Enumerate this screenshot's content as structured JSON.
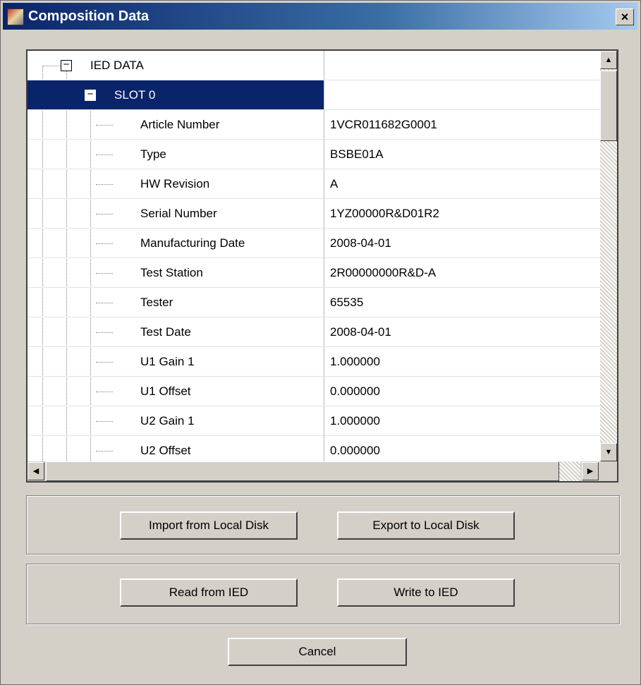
{
  "window": {
    "title": "Composition Data",
    "close_glyph": "×"
  },
  "tree": {
    "root": {
      "label": "IED DATA",
      "expander": "−"
    },
    "slot": {
      "label": "SLOT 0",
      "expander": "−"
    },
    "fields": [
      {
        "name": "Article Number",
        "value": "1VCR011682G0001"
      },
      {
        "name": "Type",
        "value": "BSBE01A"
      },
      {
        "name": "HW Revision",
        "value": "A"
      },
      {
        "name": "Serial Number",
        "value": "1YZ00000R&D01R2"
      },
      {
        "name": "Manufacturing Date",
        "value": "2008-04-01"
      },
      {
        "name": "Test Station",
        "value": "2R00000000R&D-A"
      },
      {
        "name": "Tester",
        "value": "65535"
      },
      {
        "name": "Test Date",
        "value": "2008-04-01"
      },
      {
        "name": "U1 Gain 1",
        "value": "1.000000"
      },
      {
        "name": "U1 Offset",
        "value": "0.000000"
      },
      {
        "name": "U2 Gain 1",
        "value": "1.000000"
      },
      {
        "name": "U2 Offset",
        "value": "0.000000"
      }
    ]
  },
  "scrollbars": {
    "up": "▲",
    "down": "▼",
    "left": "◀",
    "right": "▶"
  },
  "buttons": {
    "import": "Import from Local Disk",
    "export": "Export to Local Disk",
    "read": "Read from IED",
    "write": "Write to IED",
    "cancel": "Cancel"
  }
}
